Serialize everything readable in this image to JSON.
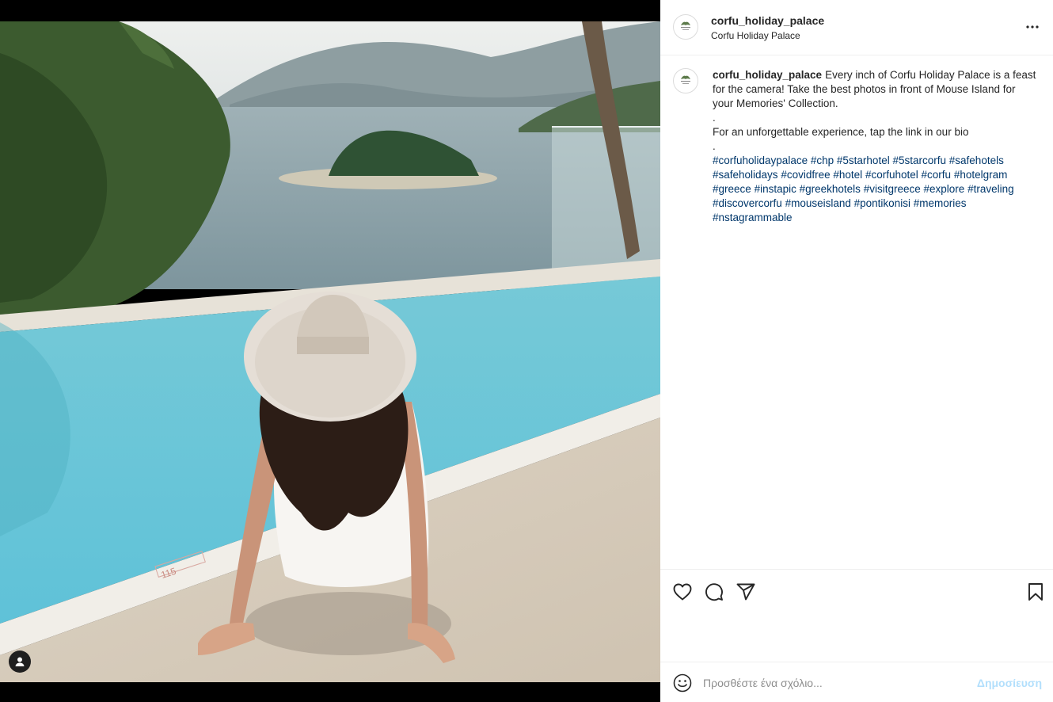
{
  "colors": {
    "accent": "#0095f6",
    "post_button_disabled": "#b2dffc",
    "hashtag": "#00376b",
    "border": "#efefef"
  },
  "post": {
    "username": "corfu_holiday_palace",
    "location": "Corfu Holiday Palace",
    "caption": {
      "username": "corfu_holiday_palace",
      "line1": "Every inch of Corfu Holiday Palace is a feast for the camera! Take the best photos in front of Mouse Island for your Memories' Collection.",
      "dot1": ".",
      "line2": "For an unforgettable experience, tap the link in our bio",
      "dot2": ".",
      "hashtags": [
        "#corfuholidaypalace",
        "#chp",
        "#5starhotel",
        "#5starcorfu",
        "#safehotels",
        "#safeholidays",
        "#covidfree",
        "#hotel",
        "#corfuhotel",
        "#corfu",
        "#hotelgram",
        "#greece",
        "#instapic",
        "#greekhotels",
        "#visitgreece",
        "#explore",
        "#traveling",
        "#discovercorfu",
        "#mouseisland",
        "#pontikonisi",
        "#memories",
        "#nstagrammable"
      ]
    },
    "photo_text": {
      "pool_depth_marker": "115"
    }
  },
  "icons": {
    "more": "more-horizontal-icon",
    "like": "heart-icon",
    "comment": "comment-bubble-icon",
    "share": "paper-plane-icon",
    "save": "bookmark-icon",
    "emoji": "smiley-icon",
    "tag_user": "user-icon"
  },
  "comment": {
    "placeholder": "Προσθέστε ένα σχόλιο...",
    "post_label": "Δημοσίευση"
  }
}
